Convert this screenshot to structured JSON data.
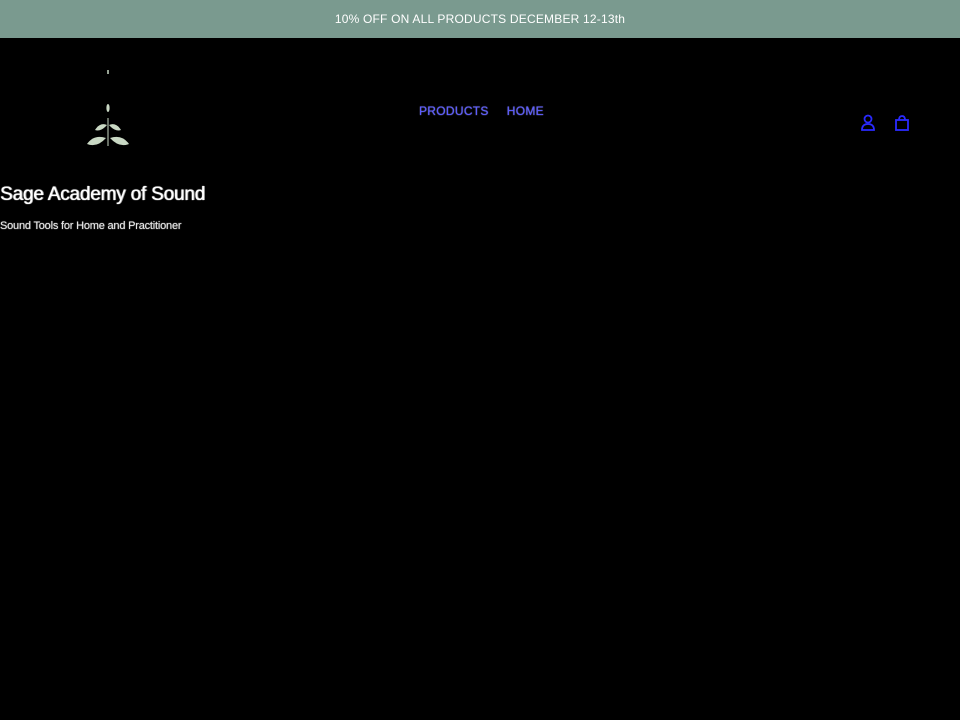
{
  "announcement": {
    "text": "10% OFF ON ALL PRODUCTS DECEMBER 12-13th"
  },
  "header": {
    "logo_icon": "leaf-logo-icon",
    "nav": [
      {
        "label": "PRODUCTS"
      },
      {
        "label": "HOME"
      }
    ],
    "icons": {
      "account": "account-icon",
      "cart": "cart-icon"
    }
  },
  "hero": {
    "title": "Sage Academy of Sound",
    "tagline": "Sound Tools for Home and Practitioner"
  },
  "colors": {
    "announcement_bg": "#7a9a8f",
    "link": "#5b5bff",
    "background": "#000000",
    "leaf": "#c9d8c4"
  }
}
